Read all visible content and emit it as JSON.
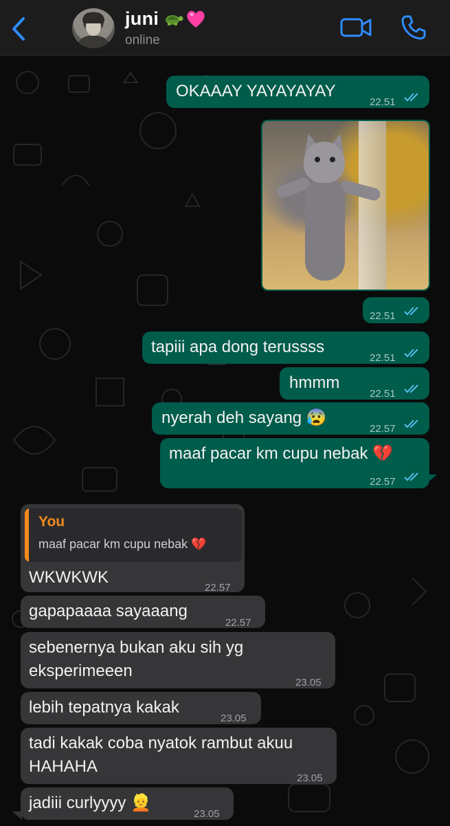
{
  "header": {
    "contact_name": "juni",
    "status": "online"
  },
  "messages": {
    "m1": {
      "text": "OKAAAY YAYAYAYAY",
      "time": "22.51"
    },
    "m2": {
      "time": "22.51"
    },
    "m3": {
      "text": "tapiii apa dong terussss",
      "time": "22.51"
    },
    "m4": {
      "text": "hmmm",
      "time": "22.51"
    },
    "m5": {
      "text": "nyerah deh sayang 😰",
      "time": "22.57"
    },
    "m6": {
      "text": "maaf pacar km cupu nebak 💔",
      "time": "22.57"
    },
    "r1": {
      "reply_author": "You",
      "reply_text": "maaf pacar km cupu nebak 💔",
      "text": "WKWKWK",
      "time": "22.57"
    },
    "r2": {
      "text": "gapapaaaa sayaaang",
      "time": "22.57"
    },
    "r3": {
      "line1": "sebenernya bukan aku sih yg",
      "line2": "eksperimeeen",
      "time": "23.05"
    },
    "r4": {
      "text": "lebih tepatnya kakak",
      "time": "23.05"
    },
    "r5": {
      "line1": "tadi kakak coba nyatok rambut akuu",
      "line2": "HAHAHA",
      "time": "23.05"
    },
    "r6": {
      "text": "jadiii curlyyyy 👱",
      "time": "23.05"
    }
  },
  "colors": {
    "outgoing_bubble": "#005c4b",
    "incoming_bubble": "#363638",
    "accent_blue": "#2f8cff",
    "reply_accent": "#f28a1e",
    "read_ticks": "#53bdeb"
  }
}
